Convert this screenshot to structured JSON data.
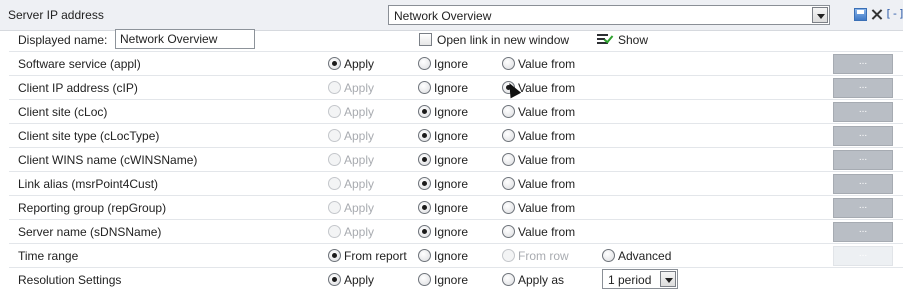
{
  "header": {
    "title": "Server IP address",
    "report_select": "Network Overview",
    "collapse_label": "[-]"
  },
  "display": {
    "name_label": "Displayed name:",
    "name_value": "Network Overview",
    "open_link_label": "Open link in new window",
    "open_link_checked": false,
    "show_label": "Show"
  },
  "rows": [
    {
      "label": "Software service (appl)",
      "selected": "apply",
      "apply_enabled": true,
      "apply": "Apply",
      "ignore": "Ignore",
      "value_from": "Value from",
      "button": "..."
    },
    {
      "label": "Client IP address (cIP)",
      "selected": "value_from",
      "apply_enabled": false,
      "apply": "Apply",
      "ignore": "Ignore",
      "value_from": "Value from",
      "button": "..."
    },
    {
      "label": "Client site (cLoc)",
      "selected": "ignore",
      "apply_enabled": false,
      "apply": "Apply",
      "ignore": "Ignore",
      "value_from": "Value from",
      "button": "..."
    },
    {
      "label": "Client site type (cLocType)",
      "selected": "ignore",
      "apply_enabled": false,
      "apply": "Apply",
      "ignore": "Ignore",
      "value_from": "Value from",
      "button": "..."
    },
    {
      "label": "Client WINS name (cWINSName)",
      "selected": "ignore",
      "apply_enabled": false,
      "apply": "Apply",
      "ignore": "Ignore",
      "value_from": "Value from",
      "button": "..."
    },
    {
      "label": "Link alias (msrPoint4Cust)",
      "selected": "ignore",
      "apply_enabled": false,
      "apply": "Apply",
      "ignore": "Ignore",
      "value_from": "Value from",
      "button": "..."
    },
    {
      "label": "Reporting group (repGroup)",
      "selected": "ignore",
      "apply_enabled": false,
      "apply": "Apply",
      "ignore": "Ignore",
      "value_from": "Value from",
      "button": "..."
    },
    {
      "label": "Server name (sDNSName)",
      "selected": "ignore",
      "apply_enabled": false,
      "apply": "Apply",
      "ignore": "Ignore",
      "value_from": "Value from",
      "button": "..."
    }
  ],
  "time_range": {
    "label": "Time range",
    "from_report": "From report",
    "ignore": "Ignore",
    "from_row": "From row",
    "advanced": "Advanced",
    "selected": "from_report",
    "button": "..."
  },
  "resolution": {
    "label": "Resolution Settings",
    "apply": "Apply",
    "ignore": "Ignore",
    "apply_as": "Apply as",
    "selected": "apply",
    "period_value": "1 period"
  },
  "colors": {
    "header_bg": "#eef0f4",
    "button_bg": "#b9bec5",
    "disabled_text": "#a8abb0"
  }
}
